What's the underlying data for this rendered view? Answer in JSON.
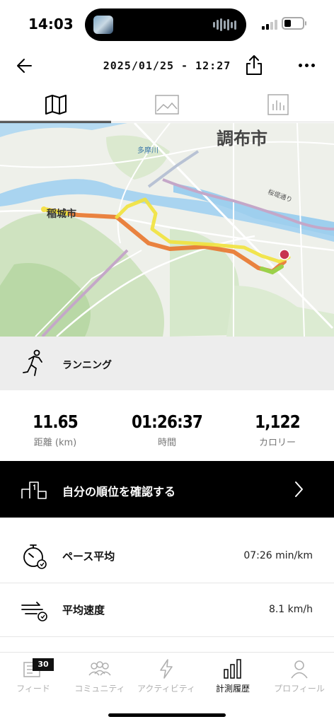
{
  "status_bar": {
    "time": "14:03"
  },
  "header": {
    "title": "2025/01/25 - 12:27"
  },
  "tabs": [
    {
      "name": "map",
      "icon": "map-icon",
      "active": true
    },
    {
      "name": "photos",
      "icon": "image-icon",
      "active": false
    },
    {
      "name": "stats",
      "icon": "bar-chart-icon",
      "active": false
    }
  ],
  "map": {
    "labels": {
      "city_chofu": "調布市",
      "city_inagi": "稲城市",
      "river": "多摩川",
      "road": "桜堤通り"
    },
    "route_colors": [
      "#f1e23c",
      "#f0a830",
      "#e8762c",
      "#9bd14a"
    ],
    "start_marker_color": "#f5e04a",
    "end_marker_color": "#c8344f"
  },
  "activity": {
    "type_label": "ランニング"
  },
  "stats": {
    "distance": {
      "value": "11.65",
      "label": "距離 (km)"
    },
    "time": {
      "value": "01:26:37",
      "label": "時間"
    },
    "calories": {
      "value": "1,122",
      "label": "カロリー"
    }
  },
  "ranking": {
    "label": "自分の順位を確認する"
  },
  "metrics": [
    {
      "name": "ペース平均",
      "value": "07:26 min/km"
    },
    {
      "name": "平均速度",
      "value": "8.1 km/h"
    }
  ],
  "nav": {
    "items": [
      {
        "label": "フィード",
        "badge": "30",
        "active": false
      },
      {
        "label": "コミュニティ",
        "active": false
      },
      {
        "label": "アクティビティ",
        "active": false
      },
      {
        "label": "計測履歴",
        "active": true
      },
      {
        "label": "プロフィール",
        "active": false
      }
    ]
  },
  "colors": {
    "accent": "#000000",
    "inactive": "#b0b0b0",
    "map_water": "#9ecfee"
  }
}
